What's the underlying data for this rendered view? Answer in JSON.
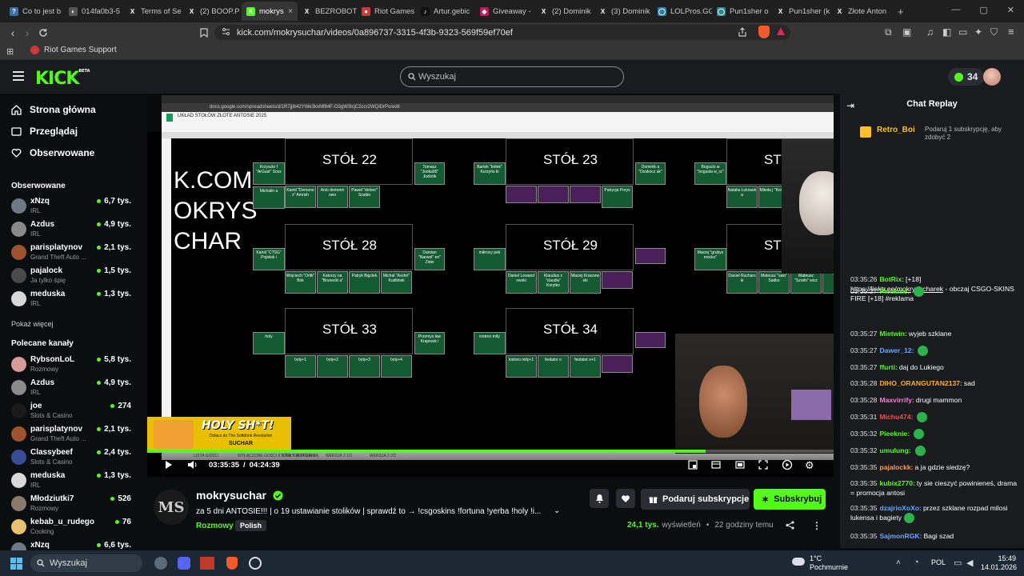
{
  "browser": {
    "tabs": [
      {
        "label": "Co to jest b",
        "color": "#3a6ea5",
        "glyph": "?"
      },
      {
        "label": "014fa0b3-5",
        "color": "#555",
        "glyph": "◐"
      },
      {
        "label": "Terms of Se",
        "color": "#222",
        "glyph": "X"
      },
      {
        "label": "(2) BOOP.P",
        "color": "#222",
        "glyph": "X"
      },
      {
        "label": "mokrys",
        "color": "#53fc18",
        "glyph": "K"
      },
      {
        "label": "BEZROBOT",
        "color": "#222",
        "glyph": "X"
      },
      {
        "label": "Riot Games",
        "color": "#d13639",
        "glyph": "●"
      },
      {
        "label": "Artur.gebic",
        "color": "#111",
        "glyph": "♪"
      },
      {
        "label": "Giveaway -",
        "color": "#c2185b",
        "glyph": "◆"
      },
      {
        "label": "(2) Dominik",
        "color": "#222",
        "glyph": "X"
      },
      {
        "label": "(3) Dominik",
        "color": "#222",
        "glyph": "X"
      },
      {
        "label": "LOLPros.GG",
        "color": "#2a7fa0",
        "glyph": "◯"
      },
      {
        "label": "Pun1sher o",
        "color": "#2a8a8a",
        "glyph": "◯"
      },
      {
        "label": "Pun1sher (k",
        "color": "#222",
        "glyph": "X"
      },
      {
        "label": "Złote Anton",
        "color": "#222",
        "glyph": "X"
      }
    ],
    "active_tab_close": "×",
    "new_tab": "+",
    "url": "kick.com/mokrysuchar/videos/0a896737-3315-4f3b-9323-569f59ef70ef",
    "bookmark": "Riot Games Support"
  },
  "header": {
    "logo": "KICK",
    "logo_sup": "BETA",
    "search_placeholder": "Wyszukaj",
    "points": "34"
  },
  "sidebar": {
    "nav": [
      {
        "label": "Strona główna",
        "icon": "home-icon"
      },
      {
        "label": "Przeglądaj",
        "icon": "browse-icon"
      },
      {
        "label": "Obserwowane",
        "icon": "heart-icon"
      }
    ],
    "followed_title": "Obserwowane",
    "followed": [
      {
        "name": "xNzq",
        "cat": "IRL",
        "viewers": "6,7 tys.",
        "color": "#6d7a86"
      },
      {
        "name": "Azdus",
        "cat": "IRL",
        "viewers": "4,9 tys.",
        "color": "#8a8a8a"
      },
      {
        "name": "parisplatynov",
        "cat": "Grand Theft Auto ...",
        "viewers": "2,1 tys.",
        "color": "#a0522d"
      },
      {
        "name": "pajalock",
        "cat": "Ja tylko śpię",
        "viewers": "1,5 tys.",
        "color": "#4a4a4a"
      },
      {
        "name": "meduska",
        "cat": "IRL",
        "viewers": "1,3 tys.",
        "color": "#d8d8d8"
      }
    ],
    "show_more": "Pokaż więcej",
    "recommended_title": "Polecane kanały",
    "recommended": [
      {
        "name": "RybsonLoL",
        "cat": "Rozmowy",
        "viewers": "5,8 tys.",
        "color": "#d99a9a"
      },
      {
        "name": "Azdus",
        "cat": "IRL",
        "viewers": "4,9 tys.",
        "color": "#8a8a8a"
      },
      {
        "name": "joe",
        "cat": "Slots & Casino",
        "viewers": "274",
        "color": "#1a1a1a"
      },
      {
        "name": "parisplatynov",
        "cat": "Grand Theft Auto ...",
        "viewers": "2,1 tys.",
        "color": "#a0522d"
      },
      {
        "name": "Classybeef",
        "cat": "Slots & Casino",
        "viewers": "2,4 tys.",
        "color": "#3a4a9a"
      },
      {
        "name": "meduska",
        "cat": "IRL",
        "viewers": "1,3 tys.",
        "color": "#d8d8d8"
      },
      {
        "name": "Młodziutki7",
        "cat": "Rozmowy",
        "viewers": "526",
        "color": "#8a7a6a"
      },
      {
        "name": "kebab_u_rudego",
        "cat": "Cooking",
        "viewers": "76",
        "color": "#e8c070"
      },
      {
        "name": "xNzq",
        "cat": "",
        "viewers": "6,6 tys.",
        "color": "#6d7a86"
      }
    ]
  },
  "video": {
    "sheet_title": "UKŁAD STOŁÓW ZŁOTE ANTOSIE 2025",
    "sheet_url": "docs.google.com/spreadsheets/d/1R7jjib42YWe3kxMf84F-O3gW3lcjC2ccr2WQiDrPo/edit",
    "watermark": [
      "K.COM",
      "OKRYS",
      "CHAR"
    ],
    "tables": [
      {
        "title": "STÓŁ 22",
        "left": [
          "Krzyszto f \"ArGust\" Sosz",
          "Michalin a"
        ],
        "bottom": [
          "Kamil \"Demone z\" Amrish",
          "Anio demonn owo",
          "Paweł \"deloro\" Szabło"
        ],
        "right": [
          "Tomasz \"Jooka95\" Jozkóik"
        ]
      },
      {
        "title": "STÓŁ 23",
        "left": [
          "Bartek \"birtek\" Kurzyńs ki"
        ],
        "bottom": [
          "",
          "",
          "",
          "Patrycja Porys"
        ],
        "right": [
          "Dominik a \"Doskocz uk\""
        ]
      },
      {
        "title": "STÓŁ 24",
        "left": [
          "Boguslo w \"bogusla w_rz\""
        ],
        "bottom": [
          "Natalia Łukosek a",
          "Mikoła j \"Knight\""
        ],
        "right": []
      },
      {
        "title": "STÓŁ 28",
        "left": [
          "Kamil \"CTSG\" Pojiełsk i"
        ],
        "bottom": [
          "Wojciech \"Orłik\" Bok",
          "Katorzy na \"Brunecki a\"",
          "Patryk Bigclek",
          "Michał \"Avshir\" Kudliński"
        ],
        "right": [
          "Damian \"Narwol\" en\" Zioło"
        ]
      },
      {
        "title": "STÓŁ 29",
        "left": [
          "mikrocy pek"
        ],
        "bottom": [
          "Daniel Lewand owski",
          "Klaudius z \"claudiu\" Korytko",
          "Maciej Kraszew ski",
          ""
        ],
        "right": [
          ""
        ]
      },
      {
        "title": "STÓŁ 30",
        "left": [
          "Maciej \"grubys mocko\""
        ],
        "bottom": [
          "Daniel Ruchars ki",
          "Mateusz \"salo\" Sadko",
          "Mateusz \"Szorło\" wicz",
          "Tworz"
        ],
        "right": []
      },
      {
        "title": "STÓŁ 33",
        "left": [
          "holy"
        ],
        "bottom": [
          "holy+1",
          "holy+2",
          "holy+3",
          "holy+4"
        ],
        "right": [
          "Przemys ław Krajewsk i"
        ]
      },
      {
        "title": "STÓŁ 34",
        "left": [
          "instreo mity"
        ],
        "bottom": [
          "instreo mity+1",
          "feolator o",
          "feolator o+1",
          ""
        ],
        "right": [
          ""
        ]
      }
    ],
    "banner_title": "HOLY SH*T!",
    "banner_sub": "Dołacz do The Softdrink Revolution",
    "banner_brand": "SUCHAR",
    "time_current": "03:35:35",
    "time_sep": "/",
    "time_total": "04:24:39",
    "progress": 0.814,
    "sheet_tabs": [
      "LISTA GOŚCI",
      "WYŁĄCZONE GOŚCI KTÓRE SIĘ POJAWIĄ",
      "STOŁY WERSJA 1",
      "WERSJA 2 1/2",
      "WERSJA 2 2/2"
    ]
  },
  "info": {
    "avatar_initials": "MS",
    "channel": "mokrysuchar",
    "title": "za 5 dni ANTOSIE!!! | o 19 ustawianie stolików | sprawdź to → !csgoskins !fortuna !yerba !holy !i...",
    "category": "Rozmowy",
    "language": "Polish",
    "views": "24,1 tys.",
    "views_label": "wyświetleń",
    "ago": "22 godziny temu",
    "gift_label": "Podaruj subskrypcje",
    "sub_label": "Subskrybuj"
  },
  "chat": {
    "title": "Chat Replay",
    "pinned_user": "Retro_Boi",
    "pinned_text": "Podaruj 1 subskrypcję, aby zdobyć 2",
    "messages": [
      {
        "ts": "03:35:26",
        "user": "BotRix:",
        "color": "#53fc18",
        "text": "[+18]",
        "link": "https://linktr.ee/mokrysucharek",
        "rest": " - obczaj CSGO-SKINS FIRE [+18] #reklama",
        "emote": false
      },
      {
        "ts": "03:35:27",
        "user": "Pieeknie:",
        "color": "#53fc18",
        "text": "",
        "emote": true
      },
      {
        "ts": "03:35:27",
        "user": "Mietwin:",
        "color": "#53fc18",
        "text": "wyjeb szklane",
        "emote": false
      },
      {
        "ts": "03:35:27",
        "user": "Dawer_12:",
        "color": "#6aa6ff",
        "text": "",
        "emote": true
      },
      {
        "ts": "03:35:27",
        "user": "ffurti:",
        "color": "#53fc18",
        "text": "daj do Lukiego",
        "emote": false
      },
      {
        "ts": "03:35:28",
        "user": "DIHO_ORANGUTAN2137:",
        "color": "#ffb020",
        "text": "sad",
        "emote": false
      },
      {
        "ts": "03:35:28",
        "user": "Maxvirrify:",
        "color": "#ff7ad9",
        "text": "drugi mammon",
        "emote": false
      },
      {
        "ts": "03:35:31",
        "user": "Michu474:",
        "color": "#ff4a4a",
        "text": "",
        "emote": true
      },
      {
        "ts": "03:35:32",
        "user": "Pieeknie:",
        "color": "#53fc18",
        "text": "",
        "emote": true
      },
      {
        "ts": "03:35:32",
        "user": "umulung:",
        "color": "#53fc18",
        "text": "",
        "emote": true
      },
      {
        "ts": "03:35:35",
        "user": "pajalockk:",
        "color": "#ff9a5a",
        "text": "a ja gdzie siedzę?",
        "emote": false
      },
      {
        "ts": "03:35:35",
        "user": "kubix2770:",
        "color": "#53fc18",
        "text": "ty sie cieszyć powinieneś, drama = promocja antosi",
        "emote": false
      },
      {
        "ts": "03:35:35",
        "user": "dzajrioXoXo:",
        "color": "#6aa6ff",
        "text": "przez szklane rozpad milosi lukensa i bagiety",
        "emote": true
      },
      {
        "ts": "03:35:35",
        "user": "SajmonRGK:",
        "color": "#6aa6ff",
        "text": "Bagi szad",
        "emote": false
      }
    ]
  },
  "taskbar": {
    "search": "Wyszukaj",
    "weather_temp": "1°C",
    "weather_desc": "Pochmurnie",
    "lang": "POL",
    "time": "15:49",
    "date": "14.01.2026"
  },
  "colors": {
    "kick_green": "#53fc18",
    "bg": "#0b0e0f",
    "panel": "#191b1f"
  }
}
